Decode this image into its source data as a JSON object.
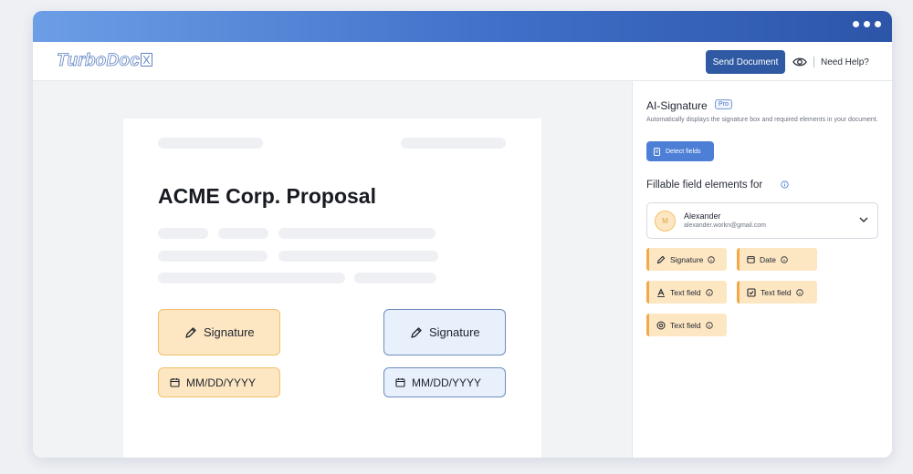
{
  "app": {
    "logo": "TurboDoc"
  },
  "header": {
    "send_label": "Send Document",
    "help_label": "Need Help?"
  },
  "document": {
    "title": "ACME Corp. Proposal",
    "signature_label": "Signature",
    "date_placeholder": "MM/DD/YYYY"
  },
  "panel": {
    "ai_title": "AI-Signature",
    "pro_badge": "Pro",
    "ai_description": "Automatically displays the signature box and required elements in your document.",
    "detect_label": "Detect fields",
    "fillable_title": "Fillable field elements for",
    "signer": {
      "initial": "M",
      "name": "Alexander",
      "email": "alexander.workn@gmail.com"
    },
    "fields": [
      {
        "label": "Signature",
        "icon": "pen-icon"
      },
      {
        "label": "Date",
        "icon": "calendar-icon"
      },
      {
        "label": "Text field",
        "icon": "text-a-icon"
      },
      {
        "label": "Text field",
        "icon": "checkbox-icon"
      },
      {
        "label": "Text field",
        "icon": "at-sign-icon"
      }
    ]
  },
  "colors": {
    "titlebar_start": "#6c9ee6",
    "titlebar_end": "#2c55a8",
    "primary_button": "#2f5aa3",
    "field_orange": "#fde7c2",
    "field_blue": "#e8f0fb"
  }
}
